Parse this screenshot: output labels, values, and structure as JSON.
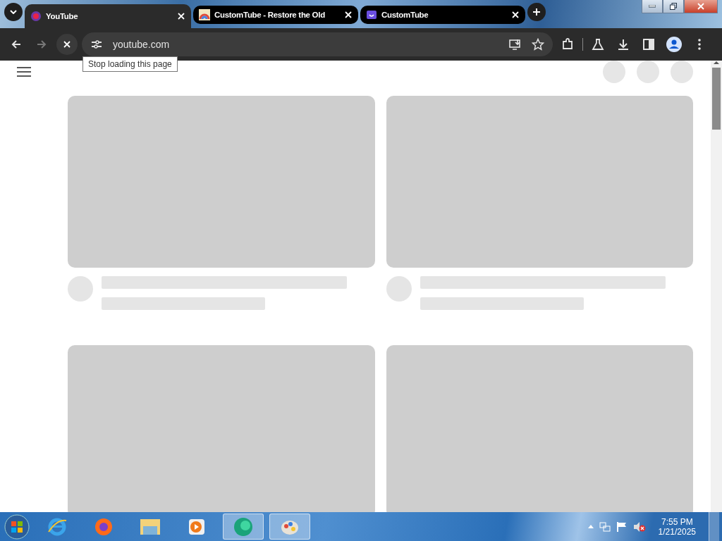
{
  "tabs": [
    {
      "title": "YouTube",
      "selected": true,
      "kind": "youtube"
    },
    {
      "title": "CustomTube - Restore the Old",
      "selected": false,
      "kind": "rainbow"
    },
    {
      "title": "CustomTube",
      "selected": false,
      "kind": "smile"
    }
  ],
  "toolbar": {
    "url": "youtube.com",
    "tooltip": "Stop loading this page"
  },
  "feed": {
    "cards": [
      {
        "kind": "full"
      },
      {
        "kind": "full"
      },
      {
        "kind": "cut"
      },
      {
        "kind": "cut"
      }
    ]
  },
  "taskbar": {
    "apps": [
      {
        "kind": "ie",
        "active": false
      },
      {
        "kind": "firefox",
        "active": false
      },
      {
        "kind": "folder",
        "active": false
      },
      {
        "kind": "player",
        "active": false
      },
      {
        "kind": "globe",
        "active": true
      },
      {
        "kind": "paint",
        "active": true
      }
    ],
    "time": "7:55 PM",
    "date": "1/21/2025"
  }
}
